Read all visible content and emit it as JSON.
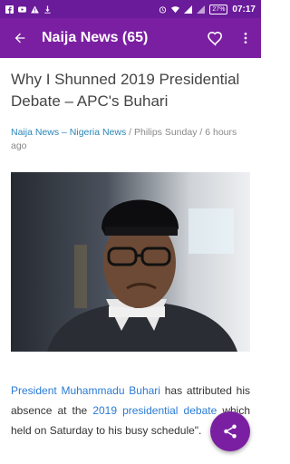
{
  "status_bar": {
    "time": "07:17",
    "battery": "27%",
    "icons": [
      "facebook-icon",
      "youtube-icon",
      "warning-icon",
      "download-icon",
      "alarm-icon",
      "wifi-icon",
      "signal-icon",
      "signal-icon"
    ]
  },
  "app_bar": {
    "title": "Naija News (65)",
    "back_icon": "arrow-back-icon",
    "favorite_icon": "heart-outline-icon",
    "more_icon": "more-vertical-icon"
  },
  "article": {
    "headline": "Why I Shunned 2019 Presidential Debate – APC's Buhari",
    "category": "Naija News – Nigeria News",
    "separator": " / ",
    "author": "Philips Sunday",
    "time": "6 hours ago",
    "body": {
      "link1": "President Muhammadu Buhari",
      "text1": " has attributed his absence at the ",
      "link2": "2019 presidential debate",
      "text2": " which held on Saturday to his busy schedule\"."
    }
  },
  "fab": {
    "icon": "share-icon"
  },
  "colors": {
    "primary": "#7b1fa2",
    "status_bar": "#6a1b9a",
    "link": "#2a7bd4"
  }
}
